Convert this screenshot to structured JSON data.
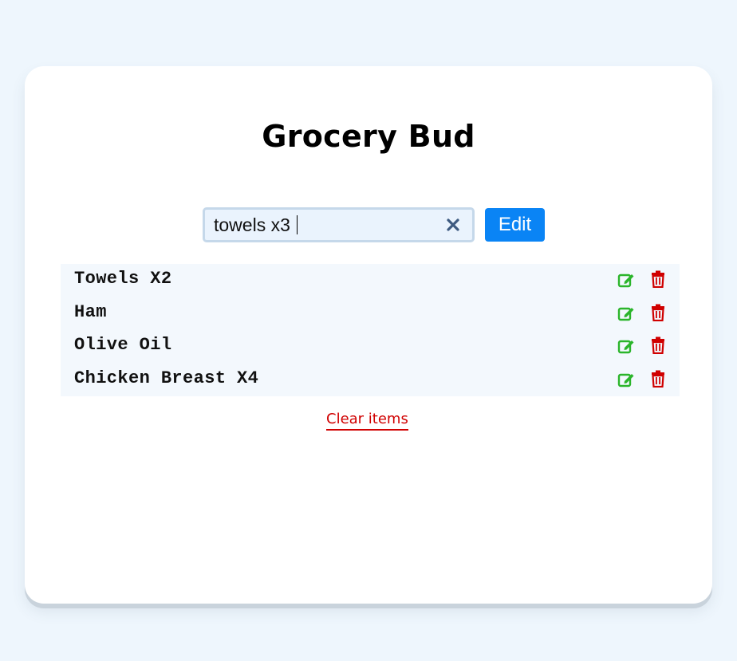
{
  "app": {
    "title": "Grocery Bud"
  },
  "form": {
    "input_value": "towels x3",
    "submit_label": "Edit"
  },
  "items": [
    {
      "label": "Towels X2"
    },
    {
      "label": "Ham"
    },
    {
      "label": "Olive Oil"
    },
    {
      "label": "Chicken Breast X4"
    }
  ],
  "footer": {
    "clear_label": "Clear items"
  },
  "colors": {
    "background": "#eef6fd",
    "card": "#ffffff",
    "accent": "#0a84f5",
    "edit_icon": "#2bb52b",
    "delete_icon": "#d00000",
    "list_background": "#f3f8fd"
  },
  "icons": {
    "clear_input": "close-icon",
    "edit": "edit-icon",
    "delete": "trash-icon"
  }
}
